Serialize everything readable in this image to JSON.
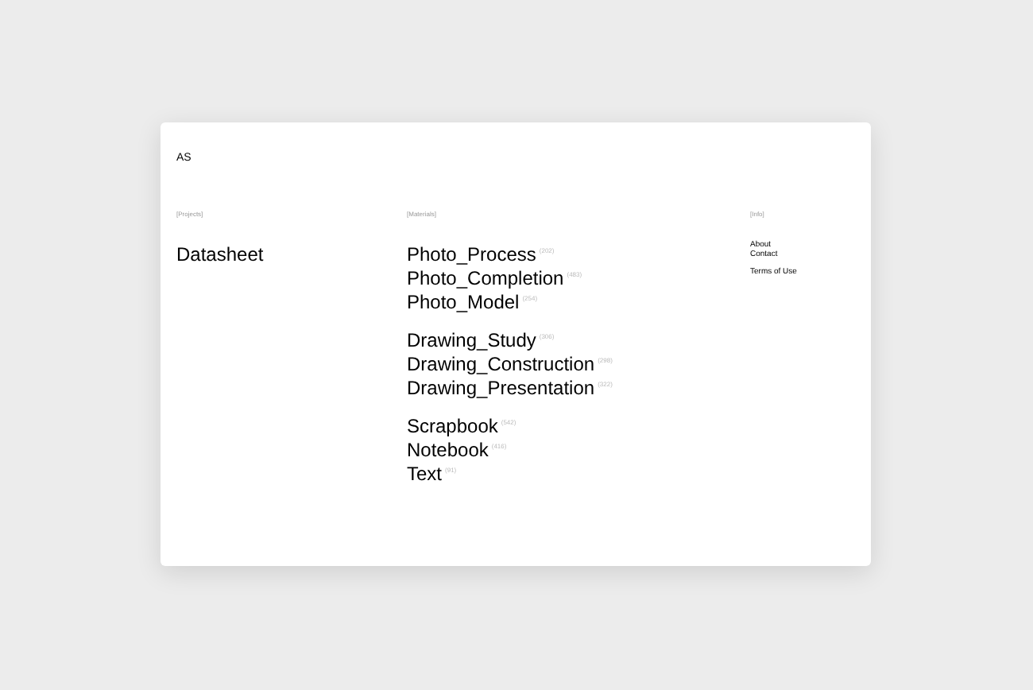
{
  "logo": "AS",
  "projects": {
    "heading": "[Projects]",
    "items": [
      "Datasheet"
    ]
  },
  "materials": {
    "heading": "[Materials]",
    "groups": [
      [
        {
          "name": "Photo_Process",
          "count": "(202)"
        },
        {
          "name": "Photo_Completion",
          "count": "(483)"
        },
        {
          "name": "Photo_Model",
          "count": "(254)"
        }
      ],
      [
        {
          "name": "Drawing_Study",
          "count": "(306)"
        },
        {
          "name": "Drawing_Construction",
          "count": "(298)"
        },
        {
          "name": "Drawing_Presentation",
          "count": "(322)"
        }
      ],
      [
        {
          "name": "Scrapbook",
          "count": "(542)"
        },
        {
          "name": "Notebook",
          "count": "(416)"
        },
        {
          "name": "Text",
          "count": "(91)"
        }
      ]
    ]
  },
  "info": {
    "heading": "[Info]",
    "groups": [
      [
        "About",
        "Contact"
      ],
      [
        "Terms of Use"
      ]
    ]
  }
}
